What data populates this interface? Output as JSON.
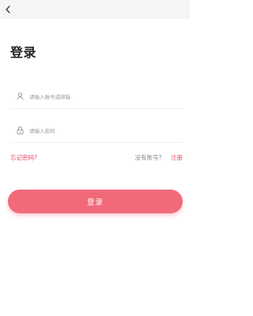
{
  "header": {
    "back_icon": "chevron-left-icon"
  },
  "title": "登录",
  "account_field": {
    "icon": "user-icon",
    "placeholder": "请输入账号或邮箱",
    "value": ""
  },
  "password_field": {
    "icon": "lock-icon",
    "placeholder": "请输入密码",
    "value": ""
  },
  "links": {
    "forgot": "忘记密码?",
    "no_account": "没有账号？",
    "register": "注册"
  },
  "login_button": {
    "label": "登录"
  },
  "colors": {
    "accent": "#f06a7a",
    "link": "#e84a5f"
  }
}
